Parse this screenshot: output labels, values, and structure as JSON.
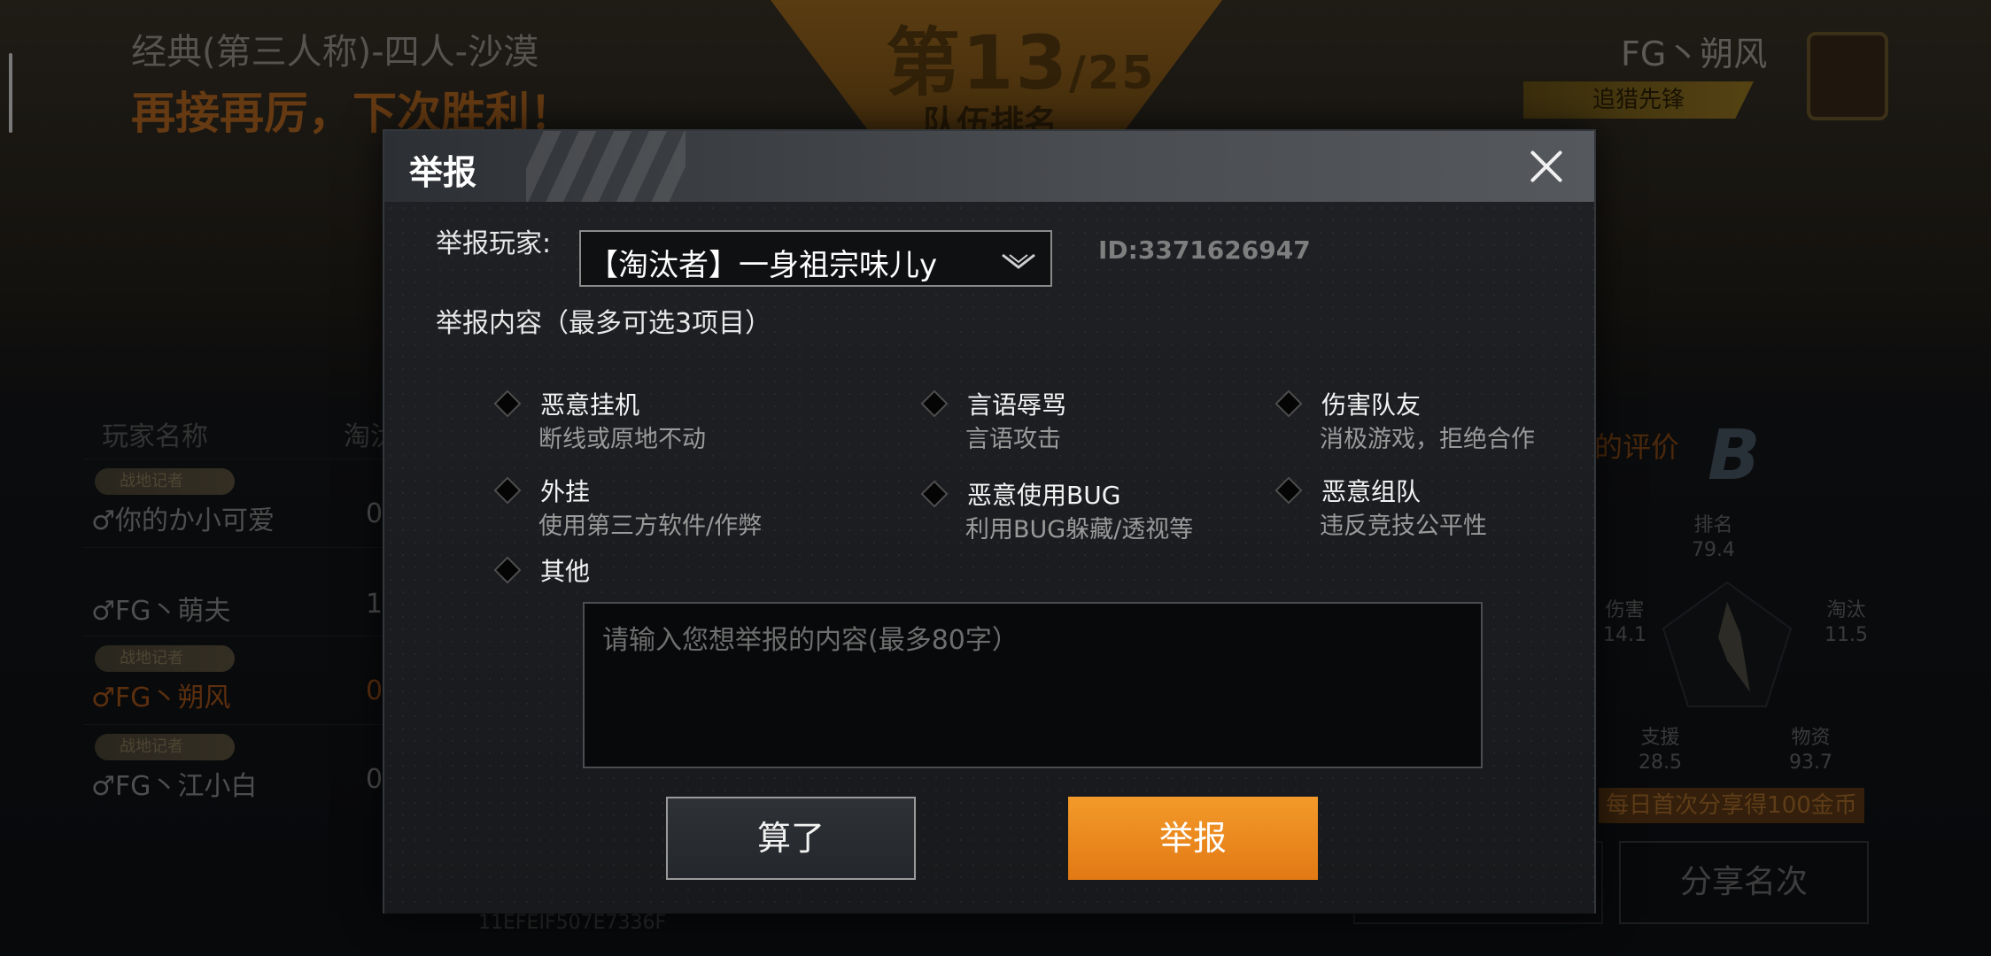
{
  "background": {
    "mode": "经典(第三人称)-四人-沙漠",
    "result_text": "再接再厉，下次胜利！",
    "rank": "第13",
    "rank_total": "/25",
    "rank_label": "队伍排名",
    "team_name": "FG丶朔风",
    "chase_label": "追猎先锋",
    "table_header_name": "玩家名称",
    "table_header_kills": "淘汰",
    "players": [
      {
        "tag": "战地记者",
        "name": "♂你的か小可爱",
        "kills": "0",
        "highlight": false
      },
      {
        "tag": "",
        "name": "♂FG丶萌夫",
        "kills": "1",
        "highlight": false
      },
      {
        "tag": "战地记者",
        "name": "♂FG丶朔风",
        "kills": "0",
        "highlight": true
      },
      {
        "tag": "战地记者",
        "name": "♂FG丶江小白",
        "kills": "0",
        "highlight": false
      }
    ],
    "evaluation_label": "的评价",
    "grade": "B",
    "stats": {
      "rank": {
        "label": "排名",
        "value": "79.4"
      },
      "damage": {
        "label": "伤害",
        "value": "14.1"
      },
      "kills": {
        "label": "淘汰",
        "value": "11.5"
      },
      "support": {
        "label": "支援",
        "value": "28.5"
      },
      "supplies": {
        "label": "物资",
        "value": "93.7"
      }
    },
    "share_tip": "每日首次分享得100金币",
    "share_button": "分享名次",
    "match_id": "11EFEIF507E7336F"
  },
  "report_dialog": {
    "title": "举报",
    "player_label": "举报玩家:",
    "selected_player": "【淘汰者】一身祖宗味儿y",
    "player_id": "ID:3371626947",
    "content_label": "举报内容（最多可选3项目）",
    "options": [
      {
        "title": "恶意挂机",
        "desc": "断线或原地不动"
      },
      {
        "title": "言语辱骂",
        "desc": "言语攻击"
      },
      {
        "title": "伤害队友",
        "desc": "消极游戏，拒绝合作"
      },
      {
        "title": "外挂",
        "desc": "使用第三方软件/作弊"
      },
      {
        "title": "恶意使用BUG",
        "desc": "利用BUG躲藏/透视等"
      },
      {
        "title": "恶意组队",
        "desc": "违反竞技公平性"
      },
      {
        "title": "其他",
        "desc": ""
      }
    ],
    "textarea_placeholder": "请输入您想举报的内容(最多80字）",
    "cancel_label": "算了",
    "submit_label": "举报",
    "colors": {
      "accent": "#F0912A",
      "header": "#3A3D41"
    }
  }
}
